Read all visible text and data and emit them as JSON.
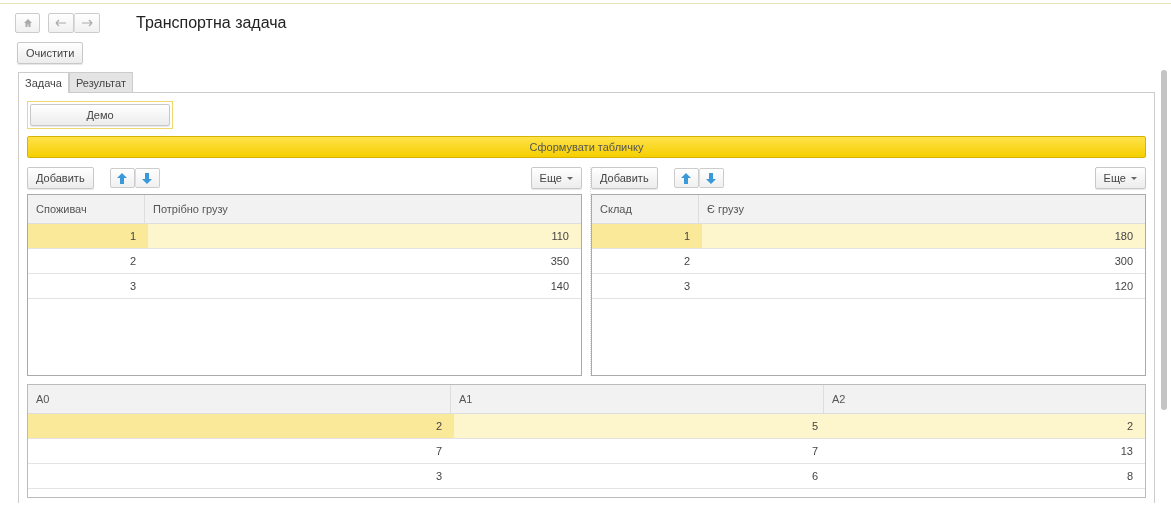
{
  "window": {
    "title": "Транспортна задача"
  },
  "clear_button": "Очистити",
  "tabs": [
    {
      "label": "Задача",
      "selected": true
    },
    {
      "label": "Результат",
      "selected": false
    }
  ],
  "demo_button": "Демо",
  "form_button": "Сформувати табличку",
  "tables": [
    {
      "add_button": "Добавить",
      "more_button": "Еще",
      "columns": [
        "Споживач",
        "Потрібно грузу"
      ],
      "rows": [
        {
          "selected": true,
          "cells": [
            "1",
            "110"
          ]
        },
        {
          "selected": false,
          "cells": [
            "2",
            "350"
          ]
        },
        {
          "selected": false,
          "cells": [
            "3",
            "140"
          ]
        }
      ]
    },
    {
      "add_button": "Добавить",
      "more_button": "Еще",
      "columns": [
        "Склад",
        "Є грузу"
      ],
      "rows": [
        {
          "selected": true,
          "cells": [
            "1",
            "180"
          ]
        },
        {
          "selected": false,
          "cells": [
            "2",
            "300"
          ]
        },
        {
          "selected": false,
          "cells": [
            "3",
            "120"
          ]
        }
      ]
    }
  ],
  "matrix": {
    "columns": [
      "A0",
      "A1",
      "A2"
    ],
    "rows": [
      {
        "selected": true,
        "cells": [
          "2",
          "5",
          "2"
        ]
      },
      {
        "selected": false,
        "cells": [
          "7",
          "7",
          "13"
        ]
      },
      {
        "selected": false,
        "cells": [
          "3",
          "6",
          "8"
        ]
      }
    ]
  }
}
